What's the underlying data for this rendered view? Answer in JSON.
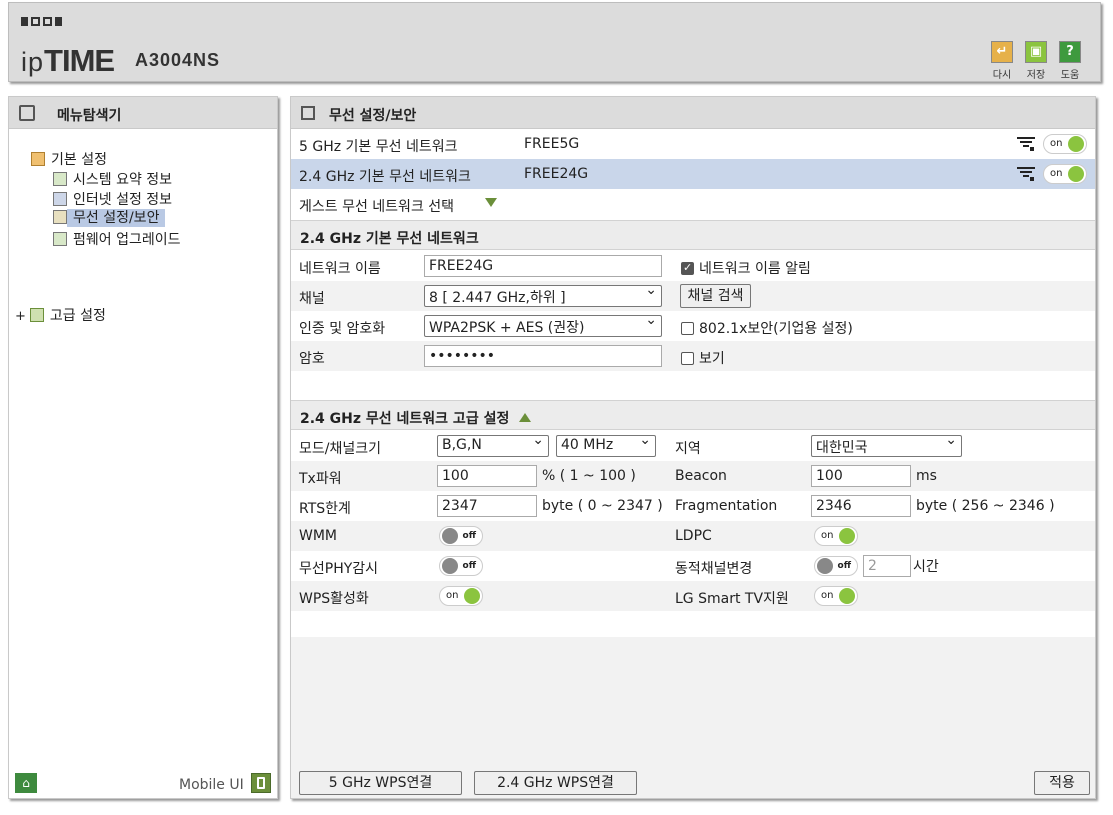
{
  "header": {
    "brand_prefix": "ip",
    "brand_bold": "TIME",
    "model": "A3004NS"
  },
  "toolbar": {
    "redo_label": "다시",
    "save_label": "저장",
    "help_label": "도움",
    "help_glyph": "?"
  },
  "sidebar": {
    "title": "메뉴탐색기",
    "basic": "기본 설정",
    "items": [
      "시스템 요약 정보",
      "인터넷 설정 정보",
      "무선 설정/보안",
      "펌웨어 업그레이드"
    ],
    "advanced_expander": "+",
    "advanced": "고급 설정",
    "mobile_ui": "Mobile UI"
  },
  "main": {
    "title": "무선 설정/보안",
    "networks": [
      {
        "label": "5 GHz 기본 무선 네트워크",
        "ssid": "FREE5G",
        "toggle": "on"
      },
      {
        "label": "2.4 GHz 기본 무선 네트워크",
        "ssid": "FREE24G",
        "toggle": "on"
      }
    ],
    "guest_select": "게스트 무선 네트워크 선택",
    "basic_section": {
      "title": "2.4 GHz 기본 무선 네트워크",
      "name_label": "네트워크 이름",
      "name_value": "FREE24G",
      "broadcast_label": "네트워크 이름 알림",
      "channel_label": "채널",
      "channel_value": "8 [ 2.447 GHz,하위 ]",
      "channel_search": "채널 검색",
      "auth_label": "인증 및 암호화",
      "auth_value": "WPA2PSK + AES (권장)",
      "dot1x_label": "802.1x보안(기업용 설정)",
      "password_label": "암호",
      "password_value": "••••••••",
      "show_label": "보기"
    },
    "adv_section": {
      "title": "2.4 GHz 무선 네트워크 고급 설정",
      "mode_label": "모드/채널크기",
      "mode_value": "B,G,N",
      "width_value": "40 MHz",
      "region_label": "지역",
      "region_value": "대한민국",
      "tx_label": "Tx파워",
      "tx_value": "100",
      "tx_range": "% ( 1 ~ 100 )",
      "beacon_label": "Beacon",
      "beacon_value": "100",
      "beacon_unit": "ms",
      "rts_label": "RTS한계",
      "rts_value": "2347",
      "rts_range": "byte ( 0 ~ 2347 )",
      "frag_label": "Fragmentation",
      "frag_value": "2346",
      "frag_range": "byte ( 256 ~ 2346 )",
      "wmm_label": "WMM",
      "wmm_toggle": "off",
      "ldpc_label": "LDPC",
      "ldpc_toggle": "on",
      "phy_label": "무선PHY감시",
      "phy_toggle": "off",
      "dyn_label": "동적채널변경",
      "dyn_toggle": "off",
      "dyn_value": "2",
      "dyn_unit": "시간",
      "wps_label": "WPS활성화",
      "wps_toggle": "on",
      "lg_label": "LG Smart TV지원",
      "lg_toggle": "on"
    },
    "footer": {
      "wps5": "5 GHz WPS연결",
      "wps24": "2.4 GHz WPS연결",
      "apply": "적용"
    }
  }
}
